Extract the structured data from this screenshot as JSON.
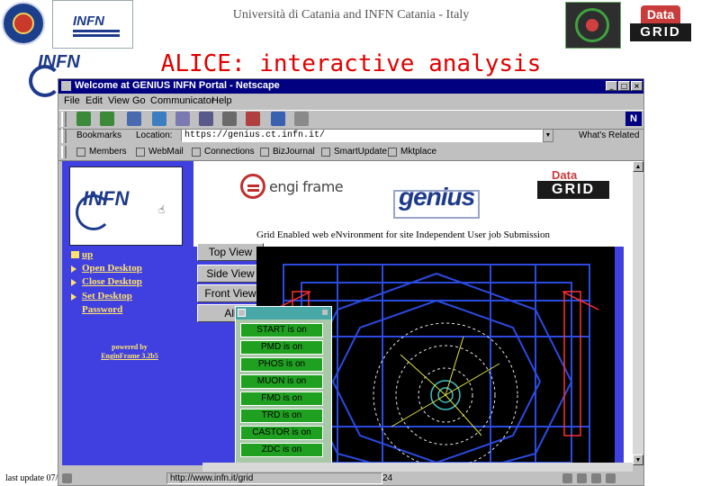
{
  "slide": {
    "header_title": "Università di Catania and INFN Catania - Italy",
    "title": "ALICE: interactive analysis",
    "footer": "last update 07/"
  },
  "browser": {
    "window_title": "Welcome at GENIUS INFN Portal - Netscape",
    "menu": [
      "File",
      "Edit",
      "View",
      "Go",
      "Communicator",
      "Help"
    ],
    "bookmarks_label": "Bookmarks",
    "location_label": "Location:",
    "url": "https://genius.ct.infn.it/",
    "whats_related": "What's Related",
    "personal_links": [
      "Members",
      "WebMail",
      "Connections",
      "BizJournal",
      "SmartUpdate",
      "Mktplace"
    ],
    "status_text": "http://www.infn.it/grid",
    "page_number": "24"
  },
  "portal": {
    "nav_up": "up",
    "nav_links": [
      "Open Desktop",
      "Close Desktop",
      "Set Desktop",
      "Password"
    ],
    "powered_by": "powered by",
    "powered_by_name": "EnginFrame 3.2b5",
    "tagline": "Grid Enabled web eNvironment for site Independent User job Submission",
    "enginframe_logo": "engi frame",
    "genius_logo": "genius",
    "datagrid_data": "Data",
    "datagrid_grid": "GRID"
  },
  "viewer": {
    "views": [
      "Top View",
      "Side View",
      "Front View",
      "All"
    ],
    "detectors": [
      "START is on",
      "PMD is on",
      "PHOS is on",
      "MUON is on",
      "FMD is on",
      "TRD is on",
      "CASTOR is on",
      "ZDC is on"
    ]
  },
  "logos": {
    "infn": "INFN",
    "datagrid_data": "Data",
    "datagrid_grid": "GRID"
  },
  "colors": {
    "title_red": "#e00000",
    "portal_blue": "#4040e0",
    "link_yellow": "#ffe36b",
    "detector_green": "#20a020"
  }
}
